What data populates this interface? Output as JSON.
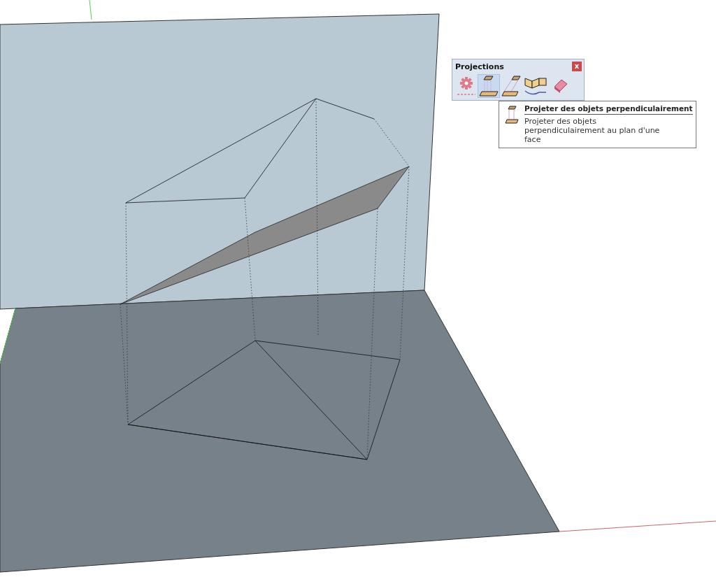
{
  "toolbar": {
    "title": "Projections",
    "close": "x",
    "buttons": [
      {
        "kind": "gear",
        "selected": false
      },
      {
        "kind": "perpendicular",
        "selected": true
      },
      {
        "kind": "oblique",
        "selected": false
      },
      {
        "kind": "unfold",
        "selected": false
      },
      {
        "kind": "eraser",
        "selected": false
      }
    ]
  },
  "tooltip": {
    "title": "Projeter des objets perpendiculairement",
    "description": "Projeter des objets perpendiculairement au plan d'une face"
  }
}
